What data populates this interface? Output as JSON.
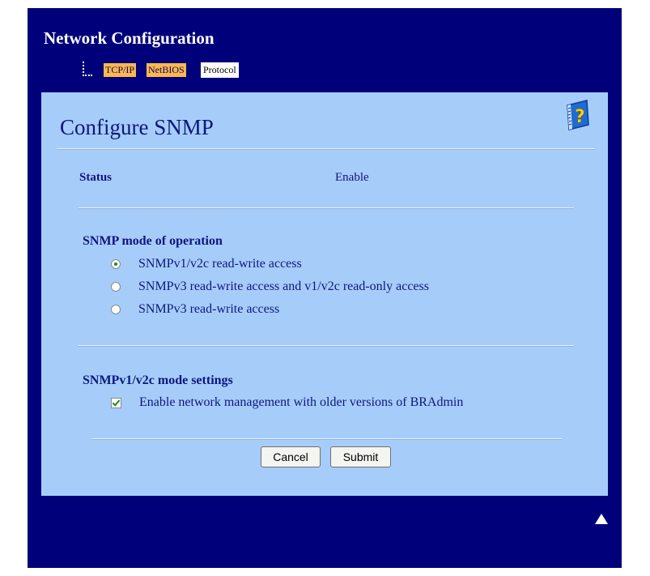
{
  "header": {
    "title": "Network Configuration",
    "tabs": [
      "TCP/IP",
      "NetBIOS",
      "Protocol"
    ],
    "active_tab": "Protocol"
  },
  "page": {
    "title": "Configure SNMP",
    "help_icon": "help-book-icon"
  },
  "status": {
    "label": "Status",
    "value": "Enable"
  },
  "mode": {
    "heading": "SNMP mode of operation",
    "options": [
      "SNMPv1/v2c read-write access",
      "SNMPv3 read-write access and v1/v2c read-only access",
      "SNMPv3 read-write access"
    ],
    "selected_index": 0
  },
  "v1v2": {
    "heading": "SNMPv1/v2c mode settings",
    "checkbox_label": "Enable network management with older versions of BRAdmin",
    "checked": true
  },
  "buttons": {
    "cancel": "Cancel",
    "submit": "Submit"
  },
  "colors": {
    "frame_bg": "#00007a",
    "panel_bg": "#a6cdf9",
    "tab_bg": "#ffb84a",
    "text": "#0d1680"
  },
  "icons": {
    "back_to_top": "up-triangle-icon"
  }
}
